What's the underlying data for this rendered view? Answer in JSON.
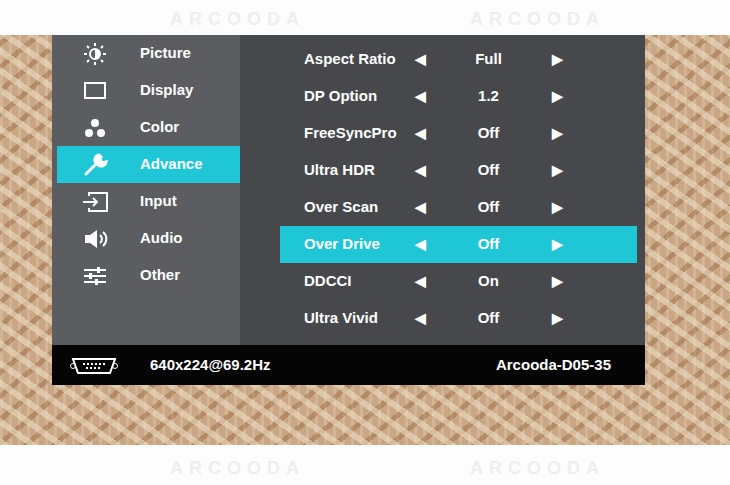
{
  "watermark": "ARCOODA",
  "sidebar": {
    "items": [
      {
        "label": "Picture",
        "selected": false
      },
      {
        "label": "Display",
        "selected": false
      },
      {
        "label": "Color",
        "selected": false
      },
      {
        "label": "Advance",
        "selected": true
      },
      {
        "label": "Input",
        "selected": false
      },
      {
        "label": "Audio",
        "selected": false
      },
      {
        "label": "Other",
        "selected": false
      }
    ]
  },
  "arrows": {
    "left": "◀",
    "right": "▶"
  },
  "settings": {
    "rows": [
      {
        "label": "Aspect Ratio",
        "value": "Full",
        "selected": false
      },
      {
        "label": "DP Option",
        "value": "1.2",
        "selected": false
      },
      {
        "label": "FreeSyncPro",
        "value": "Off",
        "selected": false
      },
      {
        "label": "Ultra HDR",
        "value": "Off",
        "selected": false
      },
      {
        "label": "Over Scan",
        "value": "Off",
        "selected": false
      },
      {
        "label": "Over Drive",
        "value": "Off",
        "selected": true
      },
      {
        "label": "DDCCI",
        "value": "On",
        "selected": false
      },
      {
        "label": "Ultra Vivid",
        "value": "Off",
        "selected": false
      }
    ]
  },
  "status_bar": {
    "resolution": "640x224@69.2Hz",
    "model": "Arcooda-D05-35"
  }
}
